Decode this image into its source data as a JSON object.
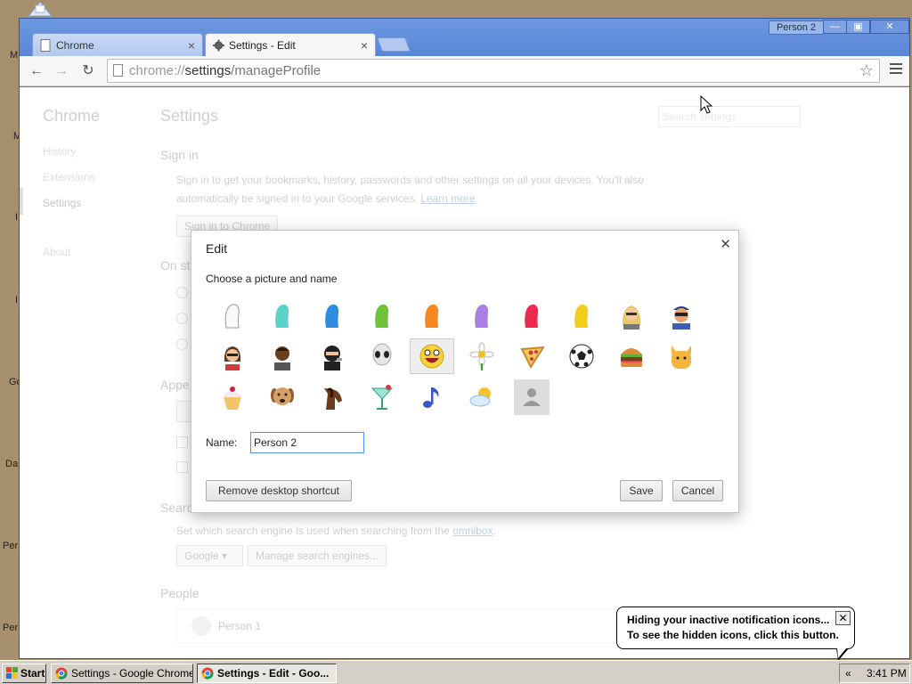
{
  "desktop": {
    "side_labels": [
      "M",
      "M",
      "I",
      "I",
      "Go",
      "Da",
      "Per",
      "Per"
    ]
  },
  "window": {
    "profile": "Person 2",
    "controls": {
      "minimize": "—",
      "maximize": "▣",
      "close": "✕"
    },
    "tabs": [
      {
        "label": "Chrome",
        "active": false
      },
      {
        "label": "Settings - Edit",
        "active": true
      }
    ]
  },
  "toolbar": {
    "url_scheme": "chrome://",
    "url_host": "settings",
    "url_path": "/manageProfile"
  },
  "settings_page": {
    "nav_title": "Chrome",
    "nav_items": [
      "History",
      "Extensions",
      "Settings",
      "About"
    ],
    "title": "Settings",
    "search_placeholder": "Search settings",
    "sign_in": {
      "heading": "Sign in",
      "text_line1": "Sign in to get your bookmarks, history, passwords and other settings on all your devices. You'll also",
      "text_line2": "automatically be signed in to your Google services.",
      "learn_more": "Learn more",
      "button": "Sign in to Chrome"
    },
    "on_startup_heading": "On st",
    "appearance_heading": "Appe",
    "search_heading": "Searc",
    "search_text": "Set which search engine is used when searching from the",
    "search_link": "omnibox",
    "search_text_end": ".",
    "search_engine": "Google",
    "manage_engines": "Manage search engines...",
    "people_heading": "People",
    "person1": "Person 1"
  },
  "dialog": {
    "title": "Edit",
    "subtitle": "Choose a picture and name",
    "avatars_row1": [
      "white-avatar",
      "cyan-avatar",
      "blue-avatar",
      "green-avatar",
      "orange-avatar",
      "purple-avatar",
      "red-avatar",
      "yellow-avatar",
      "blonde-woman-avatar",
      "sunglasses-man-avatar"
    ],
    "avatars_row2": [
      "woman-sunglasses-avatar",
      "man-avatar",
      "ninja-avatar",
      "alien-avatar",
      "awesome-face-avatar",
      "flower-avatar",
      "pizza-avatar",
      "soccer-ball-avatar",
      "burger-avatar",
      "cat-avatar"
    ],
    "avatars_row3": [
      "cupcake-avatar",
      "dog-avatar",
      "horse-avatar",
      "cocktail-avatar",
      "music-note-avatar",
      "sun-cloud-avatar",
      "generic-person-avatar"
    ],
    "name_label": "Name:",
    "name_value": "Person 2",
    "remove_shortcut": "Remove desktop shortcut",
    "save": "Save",
    "cancel": "Cancel"
  },
  "balloon": {
    "line1": "Hiding your inactive notification icons...",
    "line2": "To see the hidden icons, click this button.",
    "close": "✕"
  },
  "taskbar": {
    "start": "Start",
    "tasks": [
      {
        "label": "Settings - Google Chrome",
        "active": false
      },
      {
        "label": "Settings - Edit - Goo...",
        "active": true
      }
    ],
    "tray_chevron": "«",
    "clock": "3:41 PM"
  },
  "colors": {
    "window_frame": "#4d7cd6",
    "link": "#1155cc",
    "input_focus": "#4d90fe",
    "desktop": "#a58f6c",
    "taskbar": "#d4d0c8"
  }
}
